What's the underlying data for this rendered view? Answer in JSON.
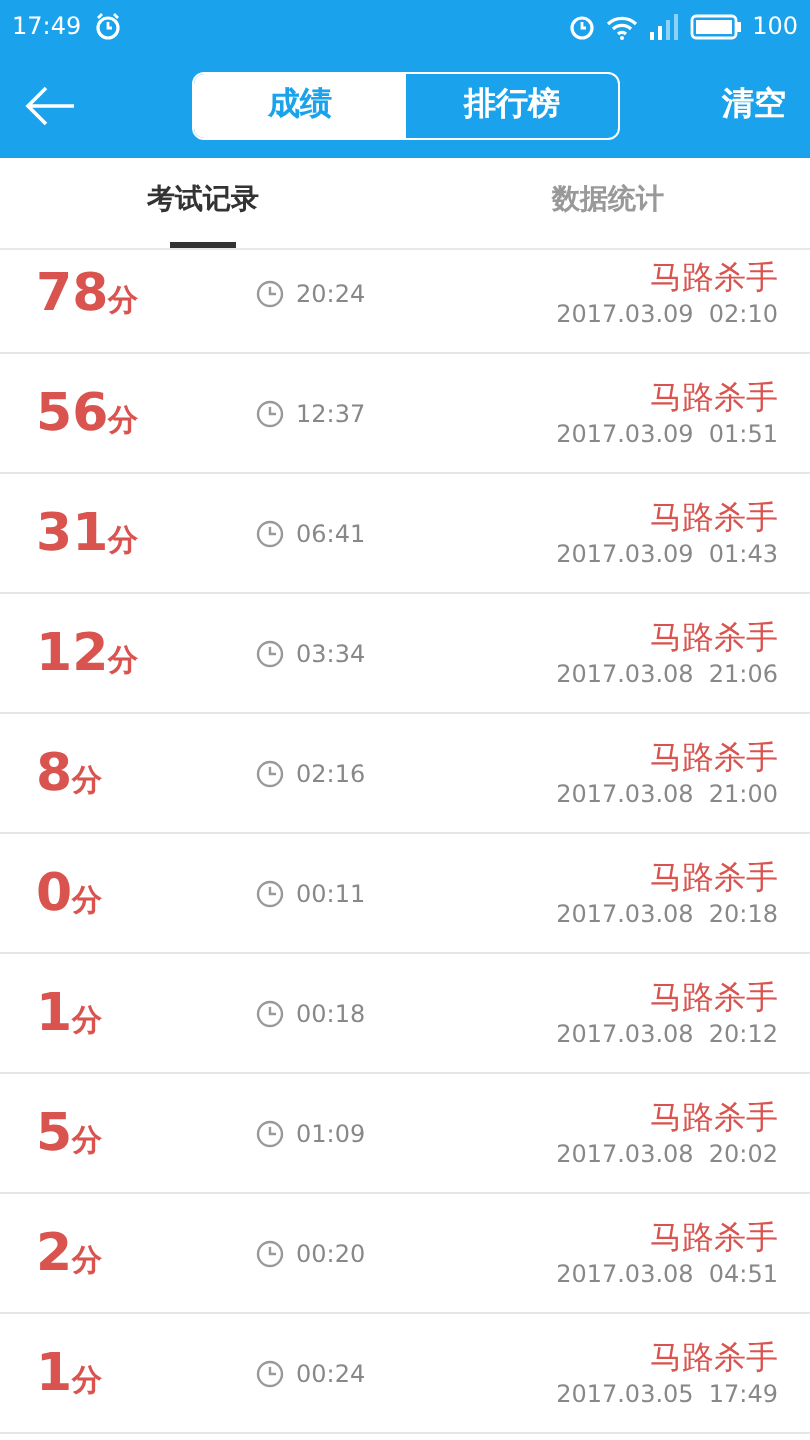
{
  "status_bar": {
    "time": "17:49",
    "battery": "100"
  },
  "header": {
    "segments": [
      {
        "label": "成绩",
        "selected": true
      },
      {
        "label": "排行榜",
        "selected": false
      }
    ],
    "action": "清空"
  },
  "tabs": [
    {
      "label": "考试记录",
      "selected": true
    },
    {
      "label": "数据统计",
      "selected": false
    }
  ],
  "records": [
    {
      "score": "78",
      "unit": "分",
      "duration": "20:24",
      "name": "马路杀手",
      "date": "2017.03.09  02:10"
    },
    {
      "score": "56",
      "unit": "分",
      "duration": "12:37",
      "name": "马路杀手",
      "date": "2017.03.09  01:51"
    },
    {
      "score": "31",
      "unit": "分",
      "duration": "06:41",
      "name": "马路杀手",
      "date": "2017.03.09  01:43"
    },
    {
      "score": "12",
      "unit": "分",
      "duration": "03:34",
      "name": "马路杀手",
      "date": "2017.03.08  21:06"
    },
    {
      "score": "8",
      "unit": "分",
      "duration": "02:16",
      "name": "马路杀手",
      "date": "2017.03.08  21:00"
    },
    {
      "score": "0",
      "unit": "分",
      "duration": "00:11",
      "name": "马路杀手",
      "date": "2017.03.08  20:18"
    },
    {
      "score": "1",
      "unit": "分",
      "duration": "00:18",
      "name": "马路杀手",
      "date": "2017.03.08  20:12"
    },
    {
      "score": "5",
      "unit": "分",
      "duration": "01:09",
      "name": "马路杀手",
      "date": "2017.03.08  20:02"
    },
    {
      "score": "2",
      "unit": "分",
      "duration": "00:20",
      "name": "马路杀手",
      "date": "2017.03.08  04:51"
    },
    {
      "score": "1",
      "unit": "分",
      "duration": "00:24",
      "name": "马路杀手",
      "date": "2017.03.05  17:49"
    }
  ]
}
